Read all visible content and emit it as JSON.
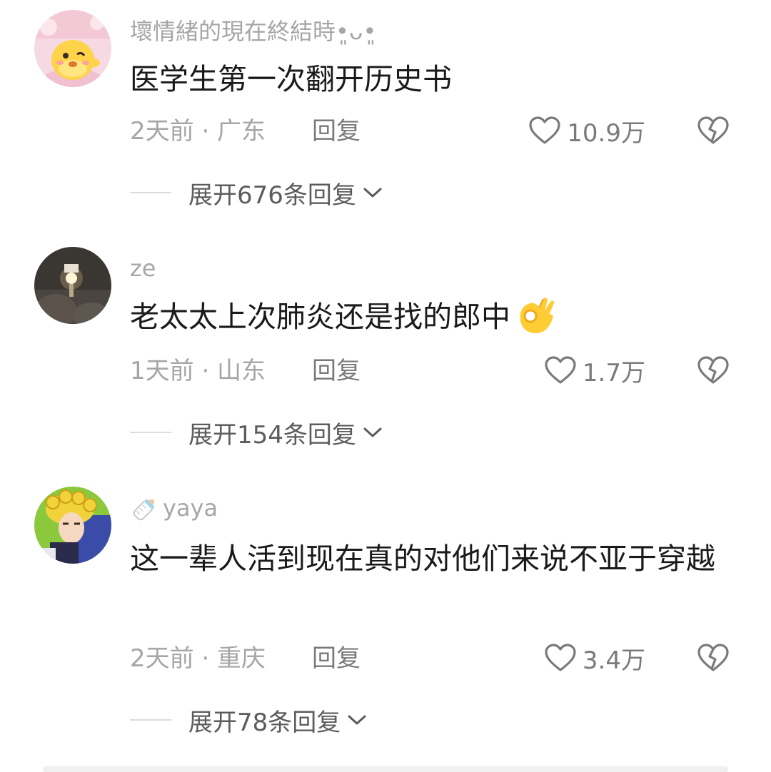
{
  "comments": [
    {
      "username": "壞情緒的現在終結時•͈ᴗ•͈",
      "text": "医学生第一次翻开历史书",
      "time_location": "2天前 · 广东",
      "reply_label": "回复",
      "likes": "10.9万",
      "expand_label": "展开676条回复",
      "avatar_icon": "cartoon-chick-avatar"
    },
    {
      "username": "ze",
      "text": "老太太上次肺炎还是找的郎中",
      "emoji": "ok-hand-emoji",
      "time_location": "1天前 · 山东",
      "reply_label": "回复",
      "likes": "1.7万",
      "expand_label": "展开154条回复",
      "avatar_icon": "light-photo-avatar"
    },
    {
      "username_prefix_icon": "baby-bottle-icon",
      "username": "yaya",
      "text": "这一辈人活到现在真的对他们来说不亚于穿越",
      "time_location": "2天前 · 重庆",
      "reply_label": "回复",
      "likes": "3.4万",
      "expand_label": "展开78条回复",
      "avatar_icon": "anime-character-avatar"
    }
  ],
  "colors": {
    "meta_gray": "#a6a6a6",
    "action_gray": "#7a7a7a",
    "text": "#1a1a1a"
  }
}
